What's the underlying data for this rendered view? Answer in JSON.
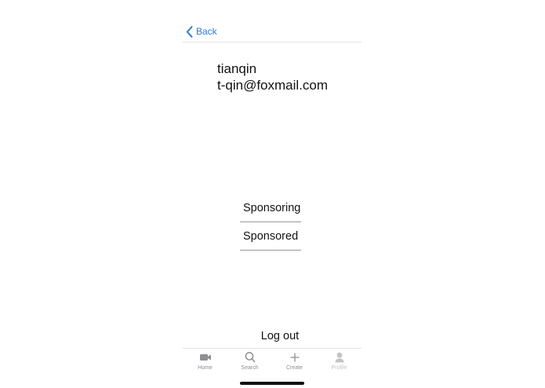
{
  "nav": {
    "back_label": "Back"
  },
  "profile": {
    "name": "tianqin",
    "email": "t-qin@foxmail.com"
  },
  "menu": {
    "items": [
      {
        "label": "Sponsoring"
      },
      {
        "label": "Sponsored"
      }
    ]
  },
  "logout": {
    "label": "Log out"
  },
  "tabs": [
    {
      "label": "Home",
      "icon": "video-camera-icon"
    },
    {
      "label": "Search",
      "icon": "search-icon"
    },
    {
      "label": "Create",
      "icon": "plus-icon"
    },
    {
      "label": "Profile",
      "icon": "person-icon"
    }
  ],
  "colors": {
    "accent": "#2f7bd8",
    "tab_label": "#8e8e93",
    "tab_label_disabled": "#c4c4c8"
  }
}
